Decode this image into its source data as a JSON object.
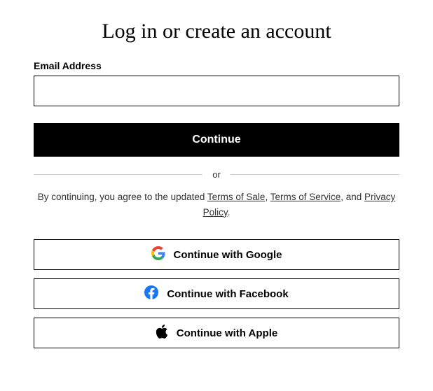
{
  "title": "Log in or create an account",
  "email": {
    "label": "Email Address",
    "value": ""
  },
  "continue_label": "Continue",
  "divider_text": "or",
  "terms": {
    "prefix": "By continuing, you agree to the updated ",
    "terms_of_sale": "Terms of Sale",
    "sep1": ", ",
    "terms_of_service": "Terms of Service",
    "sep2": ", and ",
    "privacy_policy": "Privacy Policy",
    "suffix": "."
  },
  "social": {
    "google": "Continue with Google",
    "facebook": "Continue with Facebook",
    "apple": "Continue with Apple"
  }
}
